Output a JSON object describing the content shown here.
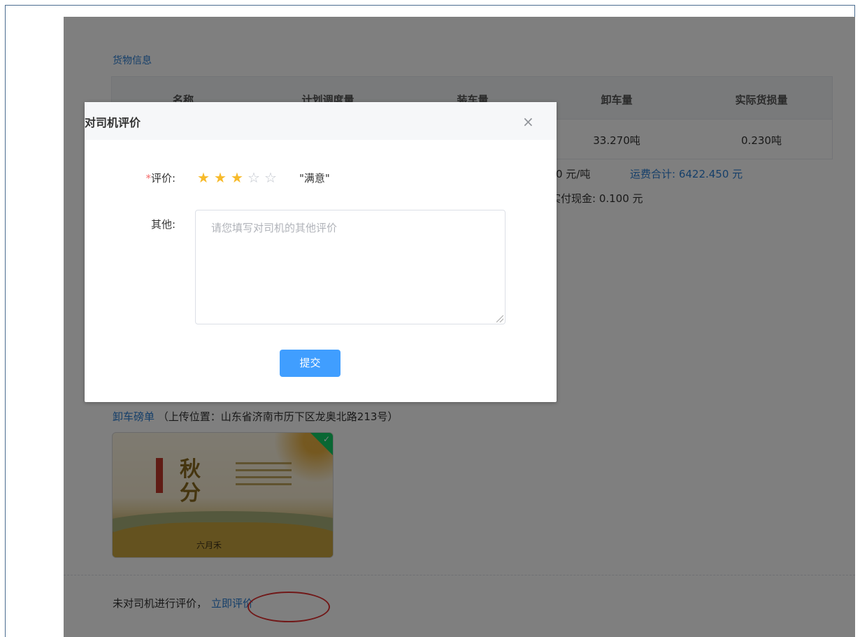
{
  "goods": {
    "section_title": "货物信息",
    "columns": [
      "名称",
      "计划调度量",
      "装车量",
      "卸车量",
      "实际货损量"
    ],
    "row": [
      "",
      "",
      "",
      "33.270吨",
      "0.230吨"
    ]
  },
  "fees": {
    "unit_price_fragment": "0 元/吨",
    "freight_total": "运费合计: 6422.450 元",
    "paid_cash": "实付现金: 0.100 元"
  },
  "unload_slip": {
    "link": "卸车磅单",
    "location": "（上传位置：山东省济南市历下区龙奥北路213号）",
    "image_text_big": "秋\n分",
    "image_brand": "六月禾"
  },
  "evaluation": {
    "prompt": "未对司机进行评价，",
    "link": "立即评价"
  },
  "dialog": {
    "title": "对司机评价",
    "close": "×",
    "rating_required": "*",
    "rating_label": "评价:",
    "rating_value": 3,
    "rating_max": 5,
    "stars": [
      "★",
      "★",
      "★",
      "☆",
      "☆"
    ],
    "rating_text": "\"满意\"",
    "other_label": "其他:",
    "other_placeholder": "请您填写对司机的其他评价",
    "submit": "提交"
  }
}
